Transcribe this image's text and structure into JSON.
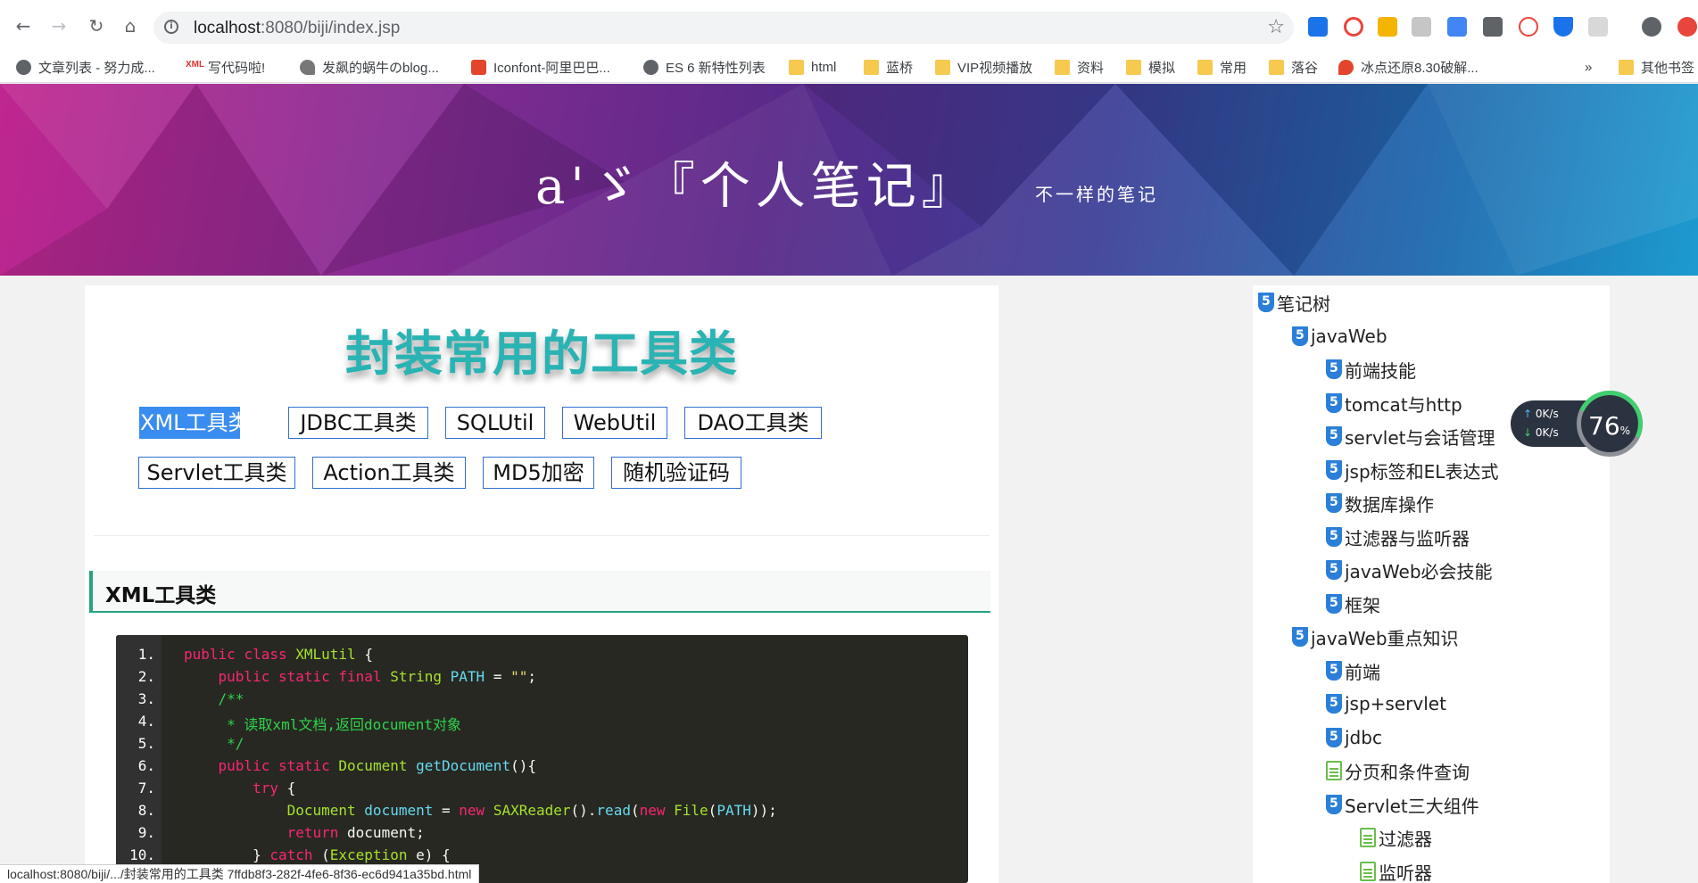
{
  "browser": {
    "url_host": "localhost",
    "url_path": ":8080/biji/index.jsp",
    "nav": {
      "back": "←",
      "forward": "→",
      "reload": "↻",
      "home": "⌂"
    },
    "bookmarks": [
      {
        "label": "文章列表 - 努力成...",
        "icon": "globe-icon"
      },
      {
        "label": "写代码啦!",
        "icon": "xml-icon"
      },
      {
        "label": "发飙的蜗牛のblog...",
        "icon": "snail-icon"
      },
      {
        "label": "Iconfont-阿里巴巴...",
        "icon": "iconfont-icon"
      },
      {
        "label": "ES 6 新特性列表",
        "icon": "globe-icon"
      },
      {
        "label": "html",
        "icon": "folder-icon"
      },
      {
        "label": "蓝桥",
        "icon": "folder-icon"
      },
      {
        "label": "VIP视频播放",
        "icon": "folder-icon"
      },
      {
        "label": "资料",
        "icon": "folder-icon"
      },
      {
        "label": "模拟",
        "icon": "folder-icon"
      },
      {
        "label": "常用",
        "icon": "folder-icon"
      },
      {
        "label": "落谷",
        "icon": "folder-icon"
      },
      {
        "label": "冰点还原8.30破解...",
        "icon": "fire-icon"
      },
      {
        "label": "»",
        "icon": ""
      },
      {
        "label": "其他书签",
        "icon": "folder-icon"
      }
    ]
  },
  "banner": {
    "title": "a'ゞ『个人笔记』",
    "subtitle": "不一样的笔记"
  },
  "article": {
    "title": "封装常用的工具类",
    "tags": [
      "XML工具类",
      "JDBC工具类",
      "SQLUtil",
      "WebUtil",
      "DAO工具类",
      "Servlet工具类",
      "Action工具类",
      "MD5加密",
      "随机验证码"
    ],
    "active_tag": "XML工具类",
    "section_heading": "XML工具类",
    "code_line_numbers": [
      "1.",
      "2.",
      "3.",
      "4.",
      "5.",
      "6.",
      "7.",
      "8.",
      "9.",
      "10."
    ],
    "code_tokens": {
      "public": "public",
      "class": "class",
      "xmlutil": "XMLutil",
      "brace_open": " {",
      "static": "static",
      "final": "final",
      "string": "String",
      "path": "PATH",
      "eq": " = ",
      "empty_str": "\"\"",
      "semi": ";",
      "comment_open": "/**",
      "comment_body": " * 读取xml文档,返回document对象",
      "comment_close": " */",
      "document": "Document",
      "get_document": "getDocument",
      "parens_brace": "(){",
      "try": "try",
      "document_var": "document",
      "new": "new",
      "saxreader": "SAXReader",
      "read": "read",
      "file": "File",
      "return": "return",
      "catch": "catch",
      "exception": "Exception",
      "e": "e"
    }
  },
  "tree": [
    {
      "label": "笔记树",
      "kind": "html5-icon"
    },
    {
      "label": "javaWeb",
      "kind": "html5-icon"
    },
    {
      "label": "前端技能",
      "kind": "html5-icon"
    },
    {
      "label": "tomcat与http",
      "kind": "html5-icon"
    },
    {
      "label": "servlet与会话管理",
      "kind": "html5-icon"
    },
    {
      "label": "jsp标签和EL表达式",
      "kind": "html5-icon"
    },
    {
      "label": "数据库操作",
      "kind": "html5-icon"
    },
    {
      "label": "过滤器与监听器",
      "kind": "html5-icon"
    },
    {
      "label": "javaWeb必会技能",
      "kind": "html5-icon"
    },
    {
      "label": "框架",
      "kind": "html5-icon"
    },
    {
      "label": "javaWeb重点知识",
      "kind": "html5-icon"
    },
    {
      "label": "前端",
      "kind": "html5-icon"
    },
    {
      "label": "jsp+servlet",
      "kind": "html5-icon"
    },
    {
      "label": "jdbc",
      "kind": "html5-icon"
    },
    {
      "label": "分页和条件查询",
      "kind": "document-icon"
    },
    {
      "label": "Servlet三大组件",
      "kind": "html5-icon"
    },
    {
      "label": "过滤器",
      "kind": "document-icon"
    },
    {
      "label": "监听器",
      "kind": "document-icon"
    }
  ],
  "speed_widget": {
    "upload": "0K/s",
    "download": "0K/s",
    "percent": "76",
    "percent_unit": "%"
  },
  "status_bar": "localhost:8080/biji/.../封装常用的工具类 7ffdb8f3-282f-4fe6-8f36-ec6d941a35bd.html",
  "colors": {
    "accent_title": "#2ab3b3",
    "tag_border": "#2f6fd1",
    "tag_active": "#3a8df0",
    "section_accent": "#27a283",
    "code_bg": "#272822"
  }
}
